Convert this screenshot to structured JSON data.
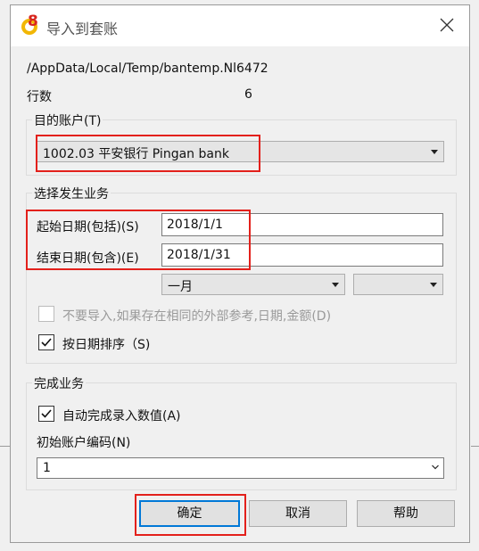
{
  "window": {
    "title": "导入到套账"
  },
  "info": {
    "path": "/AppData/Local/Temp/bantemp.Nl6472",
    "rows_label": "行数",
    "rows_value": "6"
  },
  "account_group": {
    "label": "目的账户(T)",
    "selected": "1002.03 平安银行 Pingan bank"
  },
  "business_group": {
    "label": "选择发生业务",
    "start_label": "起始日期(包括)(S)",
    "start_value": "2018/1/1",
    "end_label": "结束日期(包含)(E)",
    "end_value": "2018/1/31",
    "month_selected": "一月",
    "second_selected": "",
    "no_import_label": "不要导入,如果存在相同的外部参考,日期,金额(D)",
    "no_import_checked": false,
    "sort_label": "按日期排序（S)",
    "sort_checked": true
  },
  "complete_group": {
    "label": "完成业务",
    "auto_label": "自动完成录入数值(A)",
    "auto_checked": true,
    "code_label": "初始账户编码(N)",
    "code_selected": "1"
  },
  "buttons": {
    "ok": "确定",
    "cancel": "取消",
    "help": "帮助"
  },
  "colors": {
    "highlight": "#e3201b",
    "focus": "#0078d7",
    "icon_red": "#d7261e",
    "icon_yellow": "#f2b705"
  }
}
